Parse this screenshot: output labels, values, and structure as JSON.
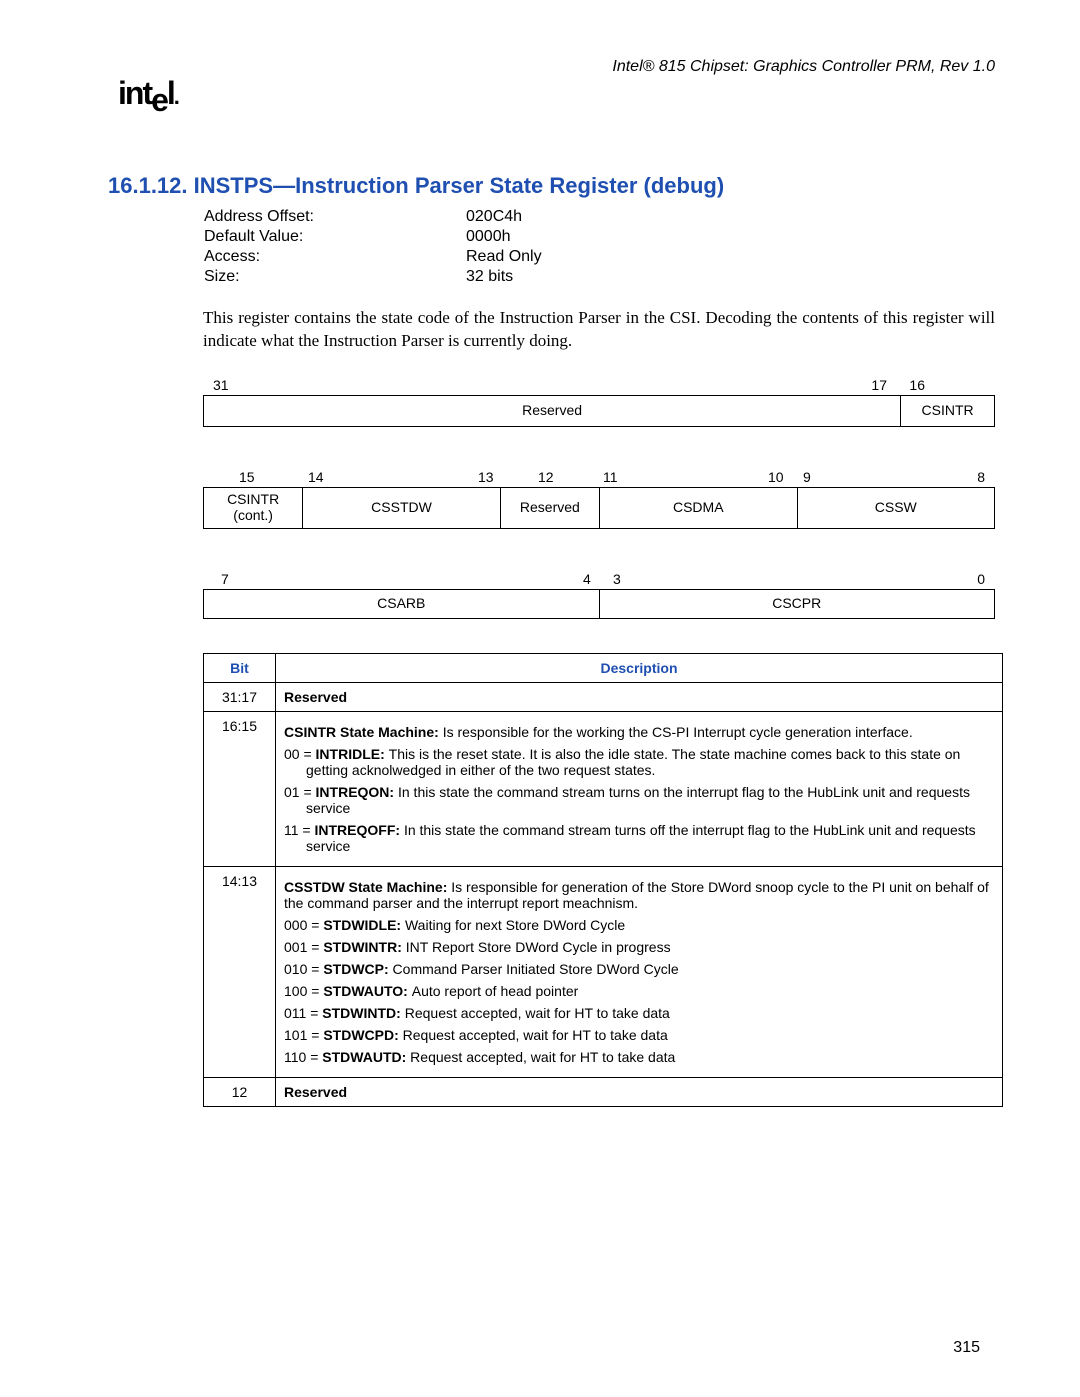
{
  "header": "Intel® 815 Chipset: Graphics Controller PRM, Rev 1.0",
  "logo": "intel",
  "section": "16.1.12.   INSTPS—Instruction Parser State Register (debug)",
  "meta": [
    {
      "label": "Address Offset:",
      "value": "020C4h"
    },
    {
      "label": "Default Value:",
      "value": "0000h"
    },
    {
      "label": "Access:",
      "value": "Read Only"
    },
    {
      "label": "Size:",
      "value": "32 bits"
    }
  ],
  "paragraph": "This register contains the state code of the Instruction Parser in the CSI. Decoding the contents of this register will indicate what the Instruction Parser is currently doing.",
  "bitrows": {
    "row1_labels": {
      "l31": "31",
      "l17": "17",
      "l16": "16"
    },
    "row1_cells": [
      "Reserved",
      "CSINTR"
    ],
    "row2_labels": {
      "l15": "15",
      "l14": "14",
      "l13": "13",
      "l12": "12",
      "l11": "11",
      "l10": "10",
      "l9": "9",
      "l8": "8"
    },
    "row2_cells": [
      "CSINTR\n(cont.)",
      "CSSTDW",
      "Reserved",
      "CSDMA",
      "CSSW"
    ],
    "row3_labels": {
      "l7": "7",
      "l4": "4",
      "l3": "3",
      "l0": "0"
    },
    "row3_cells": [
      "CSARB",
      "CSCPR"
    ]
  },
  "table_headers": {
    "bit": "Bit",
    "desc": "Description"
  },
  "rows": {
    "r1_bit": "31:17",
    "r1_text": "Reserved",
    "r2_bit": "16:15",
    "r2_line1a": "CSINTR State Machine: ",
    "r2_line1b": "Is responsible for the working the CS-PI Interrupt cycle generation interface.",
    "r2_line2a": "00 = ",
    "r2_line2b": "INTRIDLE: ",
    "r2_line2c": "This is the reset state. It is also the idle state. The state machine comes back to this state on getting acknolwedged in either of the two request states.",
    "r2_line3a": "01 = ",
    "r2_line3b": "INTREQON: ",
    "r2_line3c": "In this state the command stream turns on the interrupt flag to the HubLink unit and requests service",
    "r2_line4a": "11 = ",
    "r2_line4b": "INTREQOFF: ",
    "r2_line4c": "In this state the command stream turns off the interrupt flag to the HubLink unit and requests service",
    "r3_bit": "14:13",
    "r3_line1a": "CSSTDW State Machine: ",
    "r3_line1b": "Is responsible for generation of the Store DWord snoop cycle to the PI unit on behalf of the command parser and the interrupt report meachnism.",
    "r3_l2a": "000 = ",
    "r3_l2b": "STDWIDLE: ",
    "r3_l2c": "Waiting for next Store DWord Cycle",
    "r3_l3a": "001 = ",
    "r3_l3b": "STDWINTR: ",
    "r3_l3c": "INT Report Store DWord Cycle in progress",
    "r3_l4a": "010 = ",
    "r3_l4b": "STDWCP: ",
    "r3_l4c": "Command Parser Initiated Store DWord Cycle",
    "r3_l5a": "100 = ",
    "r3_l5b": "STDWAUTO: ",
    "r3_l5c": "Auto report of head pointer",
    "r3_l6a": "011 = ",
    "r3_l6b": "STDWINTD: ",
    "r3_l6c": "Request accepted, wait for HT to take data",
    "r3_l7a": "101 = ",
    "r3_l7b": "STDWCPD: ",
    "r3_l7c": "Request accepted, wait for HT to take data",
    "r3_l8a": "110 = ",
    "r3_l8b": "STDWAUTD: ",
    "r3_l8c": "Request accepted, wait for HT to take data",
    "r4_bit": "12",
    "r4_text": "Reserved"
  },
  "page_num": "315"
}
